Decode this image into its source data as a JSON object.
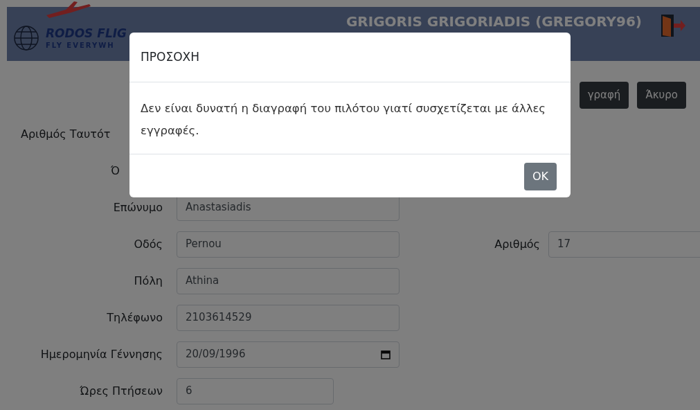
{
  "header": {
    "brand": "RODOS FLIG",
    "slogan": "FLY EVERYWH",
    "user": "GRIGORIS GRIGORIADIS (GREGORY96)"
  },
  "actions": [
    "γραφή",
    "Άκυρο"
  ],
  "form": [
    {
      "label": "Αριθμός Ταυτότ"
    },
    {
      "label": "Ό"
    },
    {
      "label": "Επώνυμο",
      "value": "Anastasiadis"
    },
    {
      "label": "Οδός",
      "value": "Pernou",
      "side": {
        "label": "Αριθμός",
        "value": "17"
      }
    },
    {
      "label": "Πόλη",
      "value": "Athina"
    },
    {
      "label": "Τηλέφωνο",
      "value": "2103614529"
    },
    {
      "label": "Ημερομηνία Γέννησης",
      "value": "20/09/1996",
      "kind": "date"
    },
    {
      "label": "Ώρες Πτήσεων",
      "value": "6",
      "kind": "short"
    }
  ],
  "dialog": {
    "title": "ΠΡΟΣΟΧΗ",
    "message": "Δεν είναι δυνατή η διαγραφή του πιλότου γιατί συσχετίζεται με άλλες εγγραφές.",
    "button": "OK"
  }
}
